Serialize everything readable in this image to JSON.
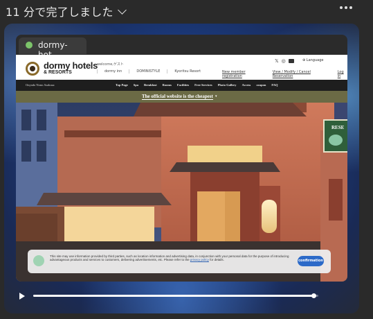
{
  "window": {
    "title": "11 分で完了しました"
  },
  "browser": {
    "tab_label": "dormy-hot…"
  },
  "site": {
    "logo_line1": "dormy hotels",
    "logo_line2": "& RESORTS",
    "welcome": "welcome,ゲスト",
    "brands": [
      "dormy inn",
      "DOMINISTYLE",
      "Kyoritsu Resort"
    ],
    "language": "⊕ Language",
    "top_links": [
      "New member registration",
      "View / Modify / Cancel Reservation",
      "Log in"
    ],
    "area": "Onyado Nono Asakusa",
    "nav": [
      "Top Page",
      "Spa",
      "Breakfast",
      "Rooms",
      "Facilities",
      "Free Services",
      "Photo Gallery",
      "Access",
      "coupon",
      "FAQ"
    ],
    "banner": "The official website is the cheapest",
    "banner_caret": "▾",
    "reserve_label": "RESE",
    "cookie_text": "This site may use information provided by third parties, such as location information and advertising data, in conjunction with your personal data for the purpose of introducing advantageous products and services to customers, delivering advertisements, etc. Please refer to the ",
    "cookie_link": "privacy policy",
    "cookie_tail": " for details.",
    "cookie_button": "confirmation"
  },
  "playback": {
    "progress": 0.985
  },
  "colors": {
    "banner_bg": "#6b6a45",
    "confirm_button": "#2c6ac8",
    "player_bg": "#1b4fa6"
  }
}
